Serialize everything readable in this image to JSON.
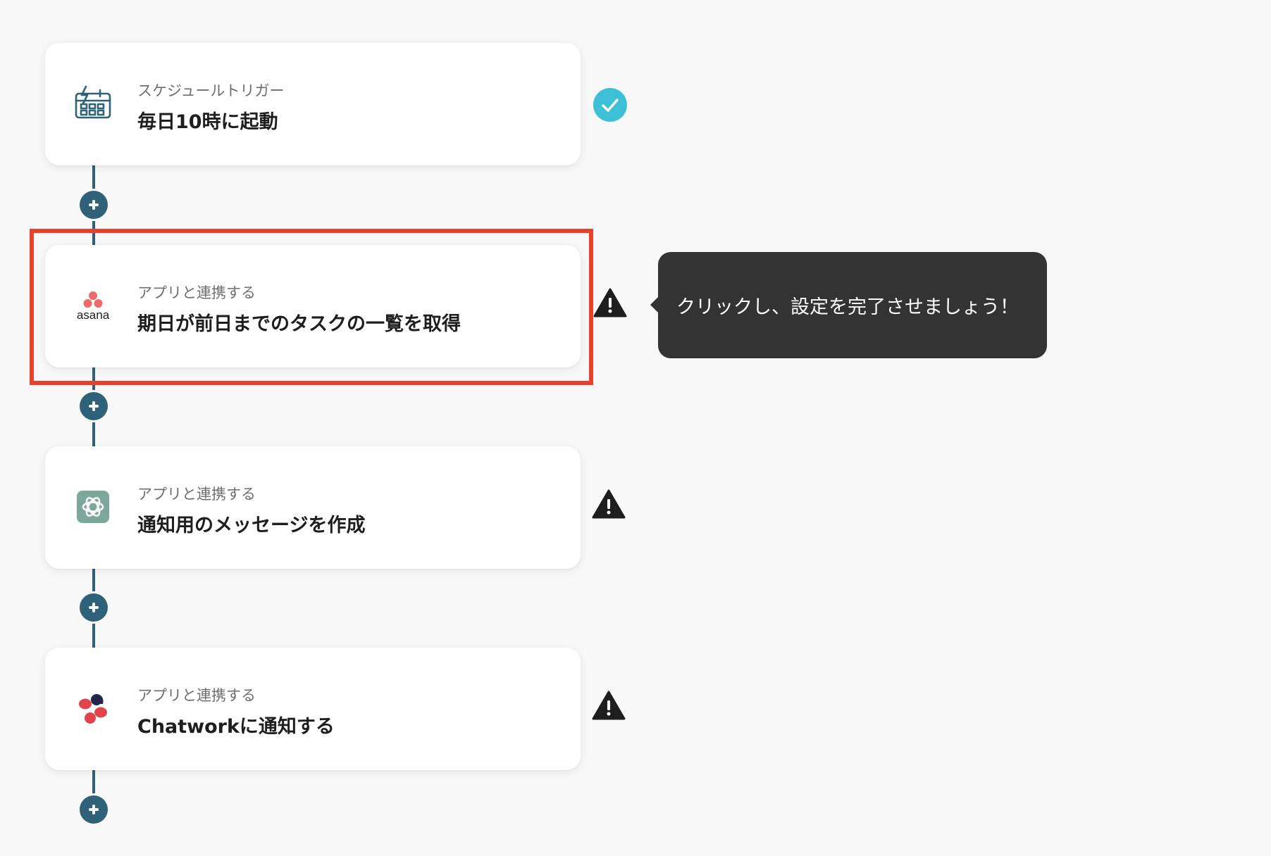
{
  "flow": {
    "steps": [
      {
        "subtitle": "スケジュールトリガー",
        "title": "毎日10時に起動",
        "icon": "calendar-schedule-icon",
        "status": "completed",
        "status_icon": "check-circle-icon"
      },
      {
        "subtitle": "アプリと連携する",
        "title": "期日が前日までのタスクの一覧を取得",
        "icon": "asana-logo-icon",
        "icon_text": "asana",
        "status": "incomplete",
        "status_icon": "warning-icon",
        "highlighted": true
      },
      {
        "subtitle": "アプリと連携する",
        "title": "通知用のメッセージを作成",
        "icon": "chatgpt-logo-icon",
        "status": "incomplete",
        "status_icon": "warning-icon"
      },
      {
        "subtitle": "アプリと連携する",
        "title": "Chatworkに通知する",
        "icon": "chatwork-logo-icon",
        "status": "incomplete",
        "status_icon": "warning-icon"
      }
    ],
    "add_step_icon": "plus-circle-icon"
  },
  "tooltip": {
    "text": "クリックし、設定を完了させましょう！"
  },
  "colors": {
    "background": "#f8f8f8",
    "connector": "#2f6179",
    "highlight_border": "#e8422c",
    "check": "#3dbfd6",
    "warning": "#1e1e1e",
    "tooltip_bg": "#333333",
    "asana": "#f06a6a",
    "chatgpt": "#7ea79b",
    "chatwork_red": "#e0454f",
    "chatwork_dark": "#22264a"
  }
}
